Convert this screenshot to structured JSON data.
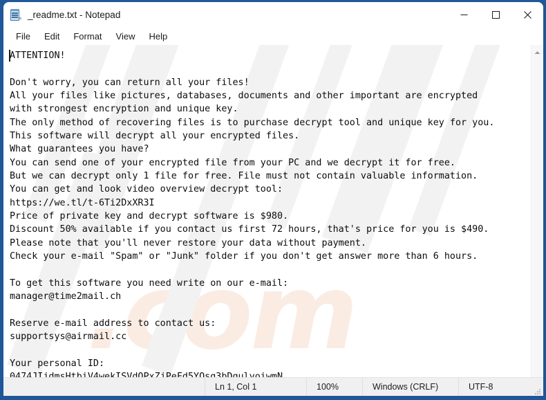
{
  "window": {
    "title": "_readme.txt - Notepad",
    "icon": "notepad-icon",
    "border_color": "#1f5799",
    "controls": {
      "minimize": "Minimize",
      "maximize": "Maximize",
      "close": "Close"
    }
  },
  "menu": {
    "items": [
      {
        "label": "File"
      },
      {
        "label": "Edit"
      },
      {
        "label": "Format"
      },
      {
        "label": "View"
      },
      {
        "label": "Help"
      }
    ]
  },
  "editor": {
    "watermark_text": ".com",
    "content": "ATTENTION!\n\nDon't worry, you can return all your files!\nAll your files like pictures, databases, documents and other important are encrypted\nwith strongest encryption and unique key.\nThe only method of recovering files is to purchase decrypt tool and unique key for you.\nThis software will decrypt all your encrypted files.\nWhat guarantees you have?\nYou can send one of your encrypted file from your PC and we decrypt it for free.\nBut we can decrypt only 1 file for free. File must not contain valuable information.\nYou can get and look video overview decrypt tool:\nhttps://we.tl/t-6Ti2DxXR3I\nPrice of private key and decrypt software is $980.\nDiscount 50% available if you contact us first 72 hours, that's price for you is $490.\nPlease note that you'll never restore your data without payment.\nCheck your e-mail \"Spam\" or \"Junk\" folder if you don't get answer more than 6 hours.\n\nTo get this software you need write on our e-mail:\nmanager@time2mail.ch\n\nReserve e-mail address to contact us:\nsupportsys@airmail.cc\n\nYour personal ID:\n0474JIjdmsHtbiV4wekISVdQPxZjPeFd5YQsg3bDgulyoiwmN",
    "url": "https://we.tl/t-6Ti2DxXR3I",
    "price_full": "$980",
    "price_discount": "$490",
    "discount_percent": "50%",
    "discount_window_hours": "72",
    "response_time_hours": "6",
    "email_primary": "manager@time2mail.ch",
    "email_reserve": "supportsys@airmail.cc",
    "personal_id": "0474JIjdmsHtbiV4wekISVdQPxZjPeFd5YQsg3bDgulyoiwmN"
  },
  "statusbar": {
    "cursor_position": "Ln 1, Col 1",
    "zoom": "100%",
    "line_ending": "Windows (CRLF)",
    "encoding": "UTF-8"
  }
}
